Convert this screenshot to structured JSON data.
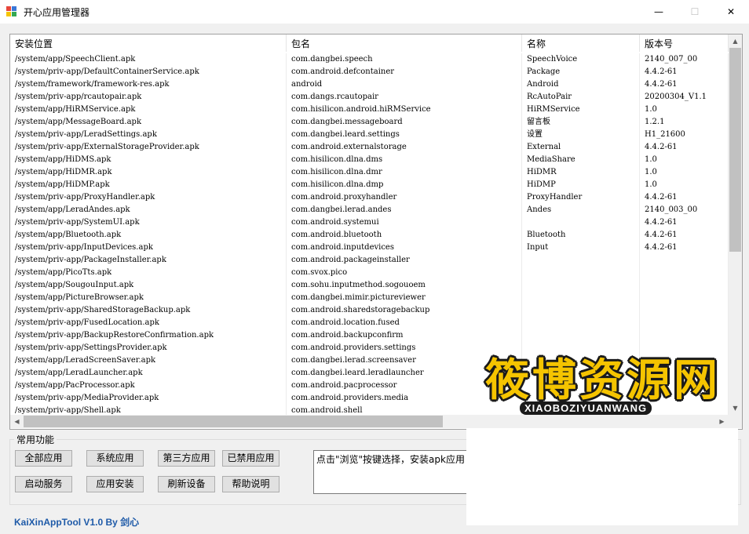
{
  "window": {
    "title": "开心应用管理器",
    "minimize_glyph": "—",
    "maximize_glyph": "☐",
    "close_glyph": "✕",
    "icon_colors": [
      "#e8463a",
      "#3a78d8",
      "#f5c400",
      "#35a853"
    ]
  },
  "table": {
    "columns": [
      "安装位置",
      "包名",
      "名称",
      "版本号"
    ],
    "rows": [
      [
        "/system/app/SpeechClient.apk",
        "com.dangbei.speech",
        "SpeechVoice",
        "2140_007_00"
      ],
      [
        "/system/priv-app/DefaultContainerService.apk",
        "com.android.defcontainer",
        "Package",
        "4.4.2-61"
      ],
      [
        "/system/framework/framework-res.apk",
        "android",
        "Android",
        "4.4.2-61"
      ],
      [
        "/system/priv-app/rcautopair.apk",
        "com.dangs.rcautopair",
        "RcAutoPair",
        "20200304_V1.1"
      ],
      [
        "/system/app/HiRMService.apk",
        "com.hisilicon.android.hiRMService",
        "HiRMService",
        "1.0"
      ],
      [
        "/system/app/MessageBoard.apk",
        "com.dangbei.messageboard",
        "留言板",
        "1.2.1"
      ],
      [
        "/system/priv-app/LeradSettings.apk",
        "com.dangbei.leard.settings",
        "设置",
        "H1_21600"
      ],
      [
        "/system/priv-app/ExternalStorageProvider.apk",
        "com.android.externalstorage",
        "External",
        "4.4.2-61"
      ],
      [
        "/system/app/HiDMS.apk",
        "com.hisilicon.dlna.dms",
        "MediaShare",
        "1.0"
      ],
      [
        "/system/app/HiDMR.apk",
        "com.hisilicon.dlna.dmr",
        "HiDMR",
        "1.0"
      ],
      [
        "/system/app/HiDMP.apk",
        "com.hisilicon.dlna.dmp",
        "HiDMP",
        "1.0"
      ],
      [
        "/system/priv-app/ProxyHandler.apk",
        "com.android.proxyhandler",
        "ProxyHandler",
        "4.4.2-61"
      ],
      [
        "/system/app/LeradAndes.apk",
        "com.dangbei.lerad.andes",
        "Andes",
        "2140_003_00"
      ],
      [
        "/system/priv-app/SystemUI.apk",
        "com.android.systemui",
        "",
        "4.4.2-61"
      ],
      [
        "/system/app/Bluetooth.apk",
        "com.android.bluetooth",
        "Bluetooth",
        "4.4.2-61"
      ],
      [
        "/system/priv-app/InputDevices.apk",
        "com.android.inputdevices",
        "Input",
        "4.4.2-61"
      ],
      [
        "/system/priv-app/PackageInstaller.apk",
        "com.android.packageinstaller",
        "",
        ""
      ],
      [
        "/system/app/PicoTts.apk",
        "com.svox.pico",
        "",
        ""
      ],
      [
        "/system/app/SougouInput.apk",
        "com.sohu.inputmethod.sogouoem",
        "",
        ""
      ],
      [
        "/system/app/PictureBrowser.apk",
        "com.dangbei.mimir.pictureviewer",
        "",
        ""
      ],
      [
        "/system/priv-app/SharedStorageBackup.apk",
        "com.android.sharedstoragebackup",
        "",
        ""
      ],
      [
        "/system/priv-app/FusedLocation.apk",
        "com.android.location.fused",
        "",
        ""
      ],
      [
        "/system/priv-app/BackupRestoreConfirmation.apk",
        "com.android.backupconfirm",
        "",
        ""
      ],
      [
        "/system/priv-app/SettingsProvider.apk",
        "com.android.providers.settings",
        "",
        ""
      ],
      [
        "/system/app/LeradScreenSaver.apk",
        "com.dangbei.lerad.screensaver",
        "",
        ""
      ],
      [
        "/system/app/LeradLauncher.apk",
        "com.dangbei.leard.leradlauncher",
        "",
        ""
      ],
      [
        "/system/app/PacProcessor.apk",
        "com.android.pacprocessor",
        "",
        ""
      ],
      [
        "/system/priv-app/MediaProvider.apk",
        "com.android.providers.media",
        "",
        ""
      ],
      [
        "/system/priv-app/Shell.apk",
        "com.android.shell",
        "",
        ""
      ]
    ]
  },
  "functions": {
    "group_title": "常用功能",
    "all_apps": "全部应用",
    "system_apps": "系统应用",
    "third_party_apps": "第三方应用",
    "disabled_apps": "已禁用应用",
    "start_service": "启动服务",
    "install_app": "应用安装",
    "refresh_device": "刷新设备",
    "help": "帮助说明",
    "info_text": "点击\"浏览\"按键选择，安装apk应用"
  },
  "footer": {
    "label": "KaiXinAppTool V1.0 By 剑心"
  },
  "watermark": {
    "main": "筱博资源网",
    "sub": "XIAOBOZIYUANWANG"
  }
}
